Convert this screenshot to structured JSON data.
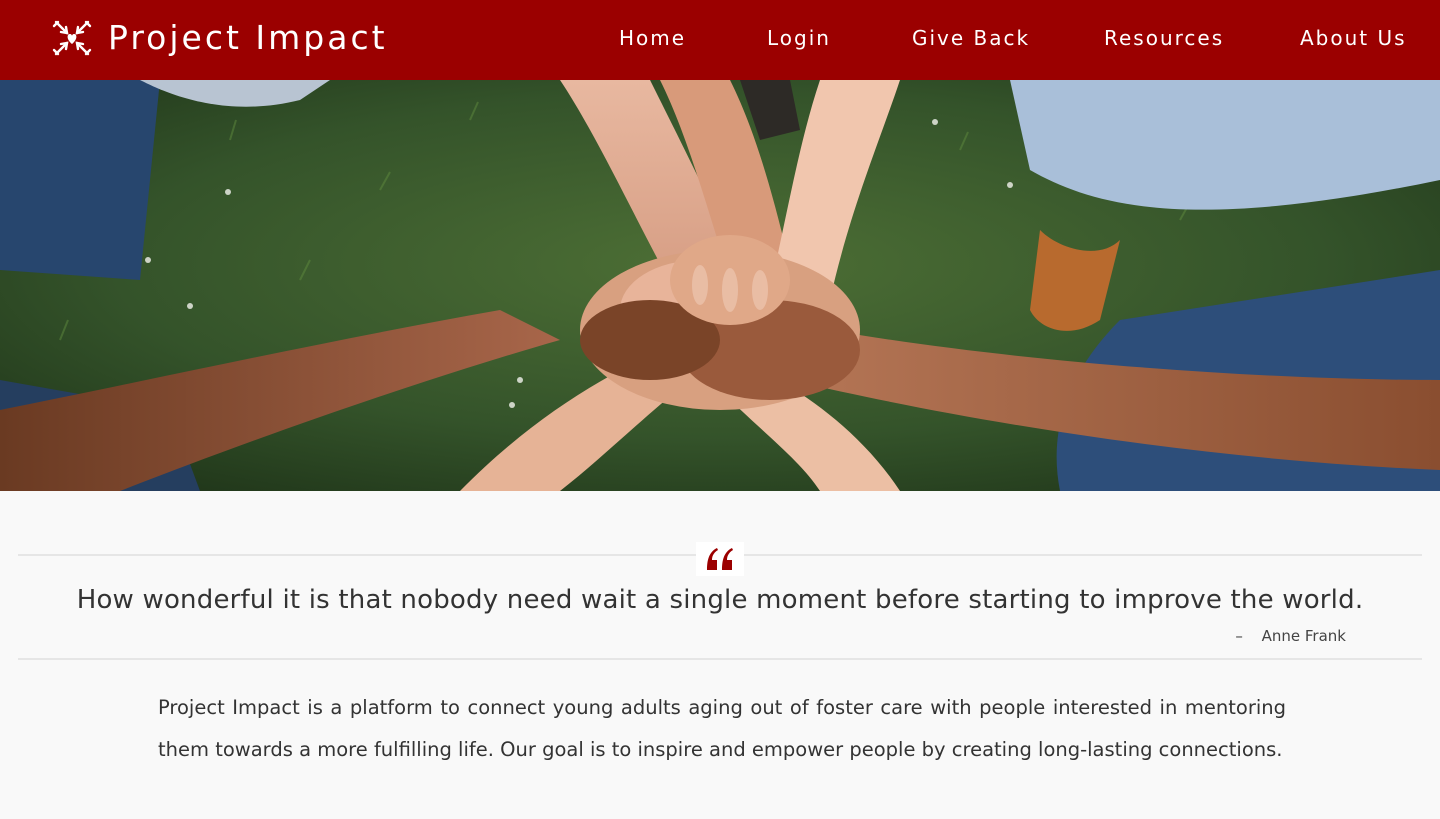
{
  "brand": {
    "name": "Project Impact",
    "icon": "arrows-heart-logo"
  },
  "nav": {
    "items": [
      {
        "label": "Home"
      },
      {
        "label": "Login"
      },
      {
        "label": "Give Back"
      },
      {
        "label": "Resources"
      },
      {
        "label": "About Us"
      }
    ]
  },
  "hero": {
    "image": "hands-stacked-on-grass-photo"
  },
  "quote": {
    "icon": "quote-mark-icon",
    "text": "How wonderful it is that nobody need wait a single moment before starting to improve the world.",
    "dash": "–",
    "author": "Anne Frank"
  },
  "mission": {
    "text": "Project Impact is a platform to connect young adults aging out of foster care with people interested in mentoring them towards a more fulfilling life. Our goal is to inspire and empower people by creating long-lasting connections."
  },
  "colors": {
    "brand": "#9b0000",
    "background": "#f9f9f9"
  }
}
